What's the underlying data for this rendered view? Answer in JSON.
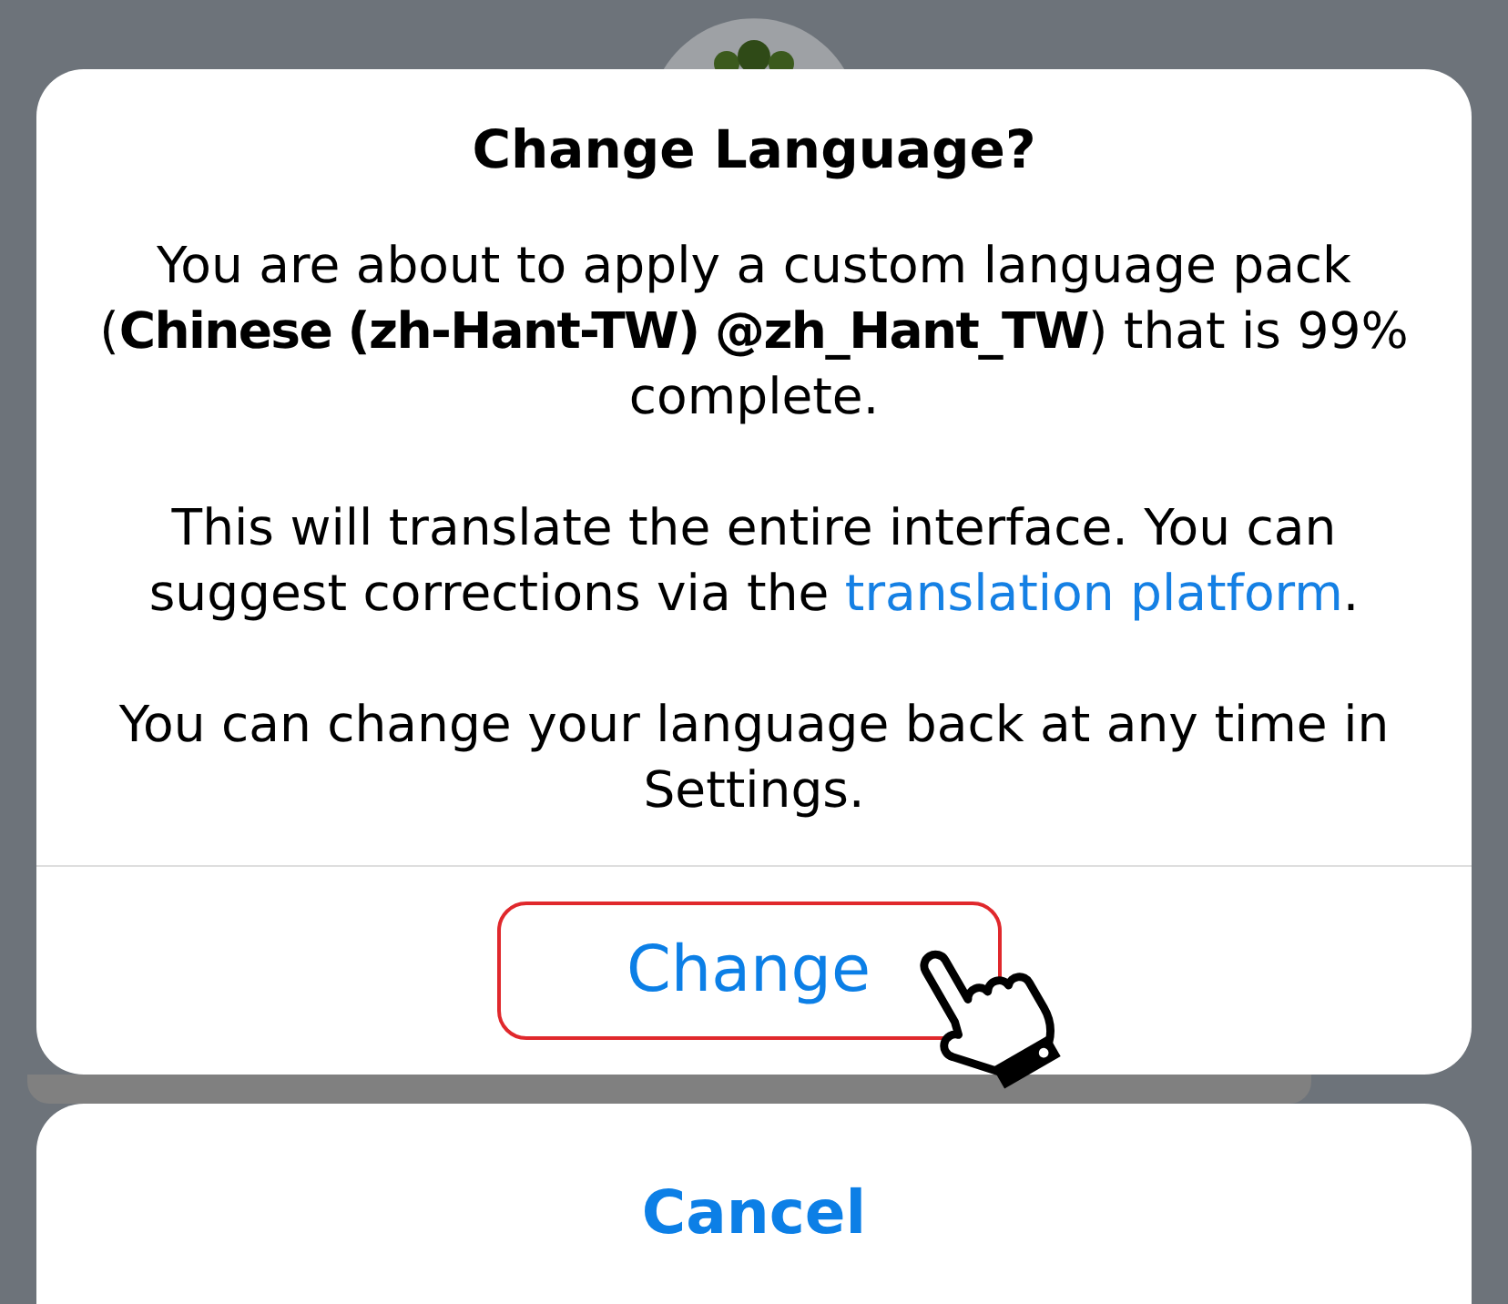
{
  "dialog": {
    "title": "Change Language?",
    "paragraphs": [
      {
        "segments": [
          {
            "kind": "text",
            "text": "You are about to apply a custom language pack (**Chinese (zh-Hant-TW) @zh_Hant_TW**) that is 99% complete."
          }
        ]
      },
      {
        "segments": [
          {
            "kind": "text",
            "text": "This will translate the entire interface. You can suggest corrections via the "
          },
          {
            "kind": "link",
            "text": "translation platform"
          },
          {
            "kind": "text",
            "text": "."
          }
        ]
      },
      {
        "segments": [
          {
            "kind": "text",
            "text": "You can change your language back at any time in Settings."
          }
        ]
      }
    ],
    "actions": [
      {
        "label": "Change",
        "highlighted": true
      }
    ]
  },
  "cancel_action": {
    "label": "Cancel"
  }
}
